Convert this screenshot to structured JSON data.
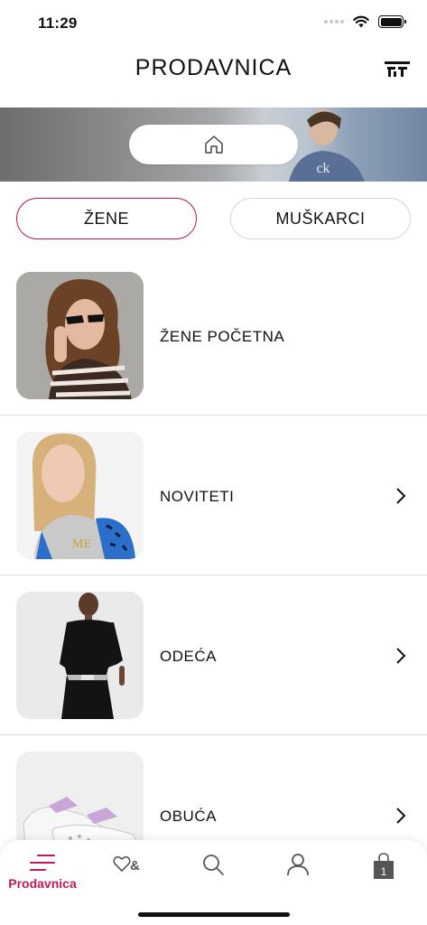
{
  "status_bar": {
    "time": "11:29"
  },
  "header": {
    "title": "PRODAVNICA",
    "logo_icon": "brand-logo-icon"
  },
  "hero": {
    "home_icon": "home-icon"
  },
  "gender_tabs": [
    {
      "label": "ŽENE",
      "selected": true
    },
    {
      "label": "MUŠKARCI",
      "selected": false
    }
  ],
  "categories": [
    {
      "label": "ŽENE POČETNA",
      "has_chevron": false
    },
    {
      "label": "NOVITETI",
      "has_chevron": true
    },
    {
      "label": "ODEĆA",
      "has_chevron": true
    },
    {
      "label": "OBUĆA",
      "has_chevron": true
    }
  ],
  "tab_bar": {
    "items": [
      {
        "label": "Prodavnica",
        "icon": "menu-lines-icon",
        "active": true
      },
      {
        "icon": "wishlist-icon"
      },
      {
        "icon": "search-icon"
      },
      {
        "icon": "user-icon"
      },
      {
        "icon": "shopping-bag-icon",
        "badge": "1"
      }
    ]
  },
  "colors": {
    "accent": "#c2185b",
    "border": "#dcdcdc",
    "text": "#111111"
  }
}
